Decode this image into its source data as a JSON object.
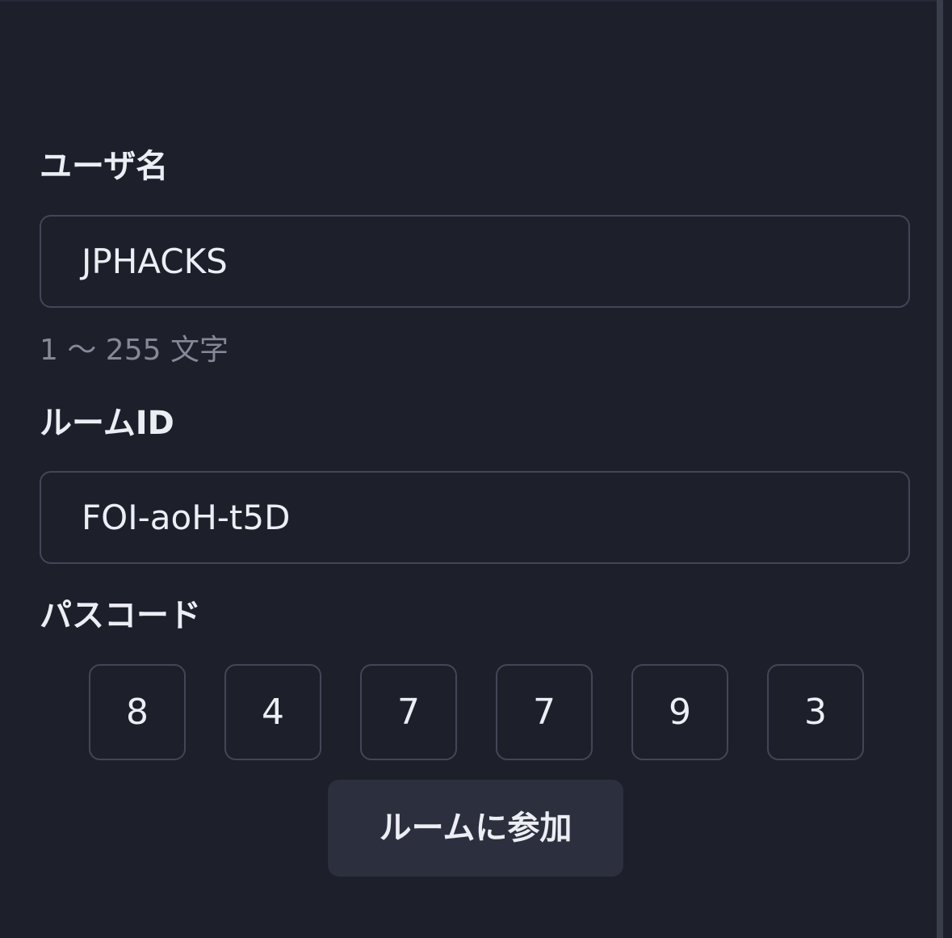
{
  "form": {
    "username": {
      "label": "ユーザ名",
      "value": "JPHACKS",
      "hint": "1 ～ 255 文字"
    },
    "room_id": {
      "label": "ルームID",
      "value": "FOI-aoH-t5D"
    },
    "passcode": {
      "label": "パスコード",
      "digits": [
        "8",
        "4",
        "7",
        "7",
        "9",
        "3"
      ]
    },
    "join_button_label": "ルームに参加"
  }
}
